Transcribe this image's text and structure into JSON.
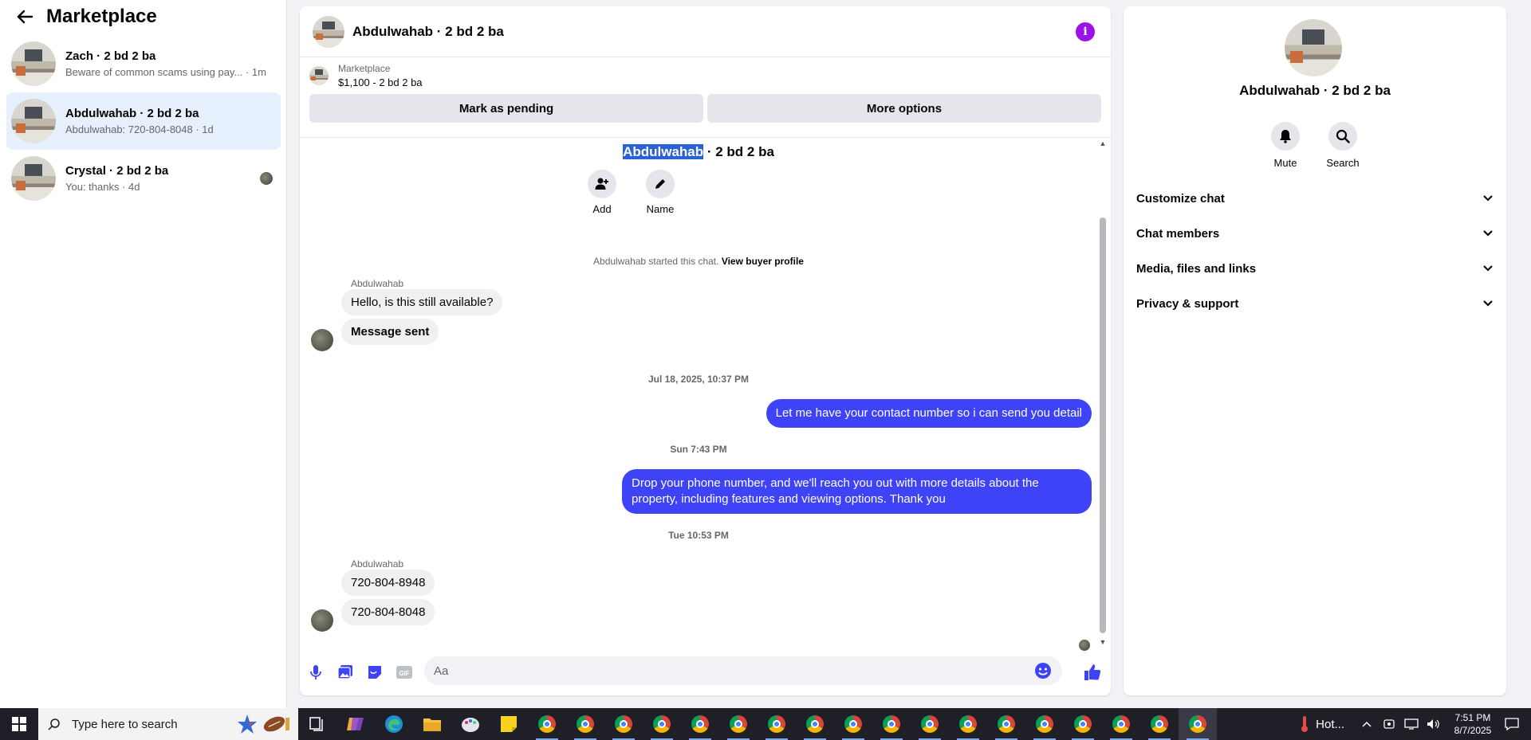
{
  "sidebar": {
    "title": "Marketplace",
    "conversations": [
      {
        "name": "Zach · 2 bd 2 ba",
        "subtitle": "Beware of common scams using pay... · 1m"
      },
      {
        "name": "Abdulwahab · 2 bd 2 ba",
        "subtitle": "Abdulwahab: 720-804-8048 · 1d"
      },
      {
        "name": "Crystal · 2 bd 2 ba",
        "subtitle": "You: thanks · 4d"
      }
    ]
  },
  "chat": {
    "title": "Abdulwahab · 2 bd 2 ba",
    "listing_source": "Marketplace",
    "listing_price": "$1,100 - 2 bd 2 ba",
    "mark_pending_label": "Mark as pending",
    "more_options_label": "More options",
    "conv_title_highlight": "Abdulwahab",
    "conv_title_rest": " · 2 bd 2 ba",
    "add_label": "Add",
    "name_label": "Name",
    "started_text": "Abdulwahab started this chat.",
    "view_profile_label": "View buyer profile",
    "messages": {
      "sender1": "Abdulwahab",
      "in1": "Hello, is this still available?",
      "in2": "Message sent",
      "ts1": "Jul 18, 2025, 10:37 PM",
      "out1": "Let me have your contact number so i can send you detail",
      "ts2": "Sun 7:43 PM",
      "out2": "Drop your phone number, and we'll reach you out with more details about the property, including features and viewing options.  Thank you",
      "ts3": "Tue 10:53 PM",
      "sender2": "Abdulwahab",
      "in3": "720-804-8948",
      "in4": "720-804-8048"
    },
    "composer_placeholder": "Aa",
    "composer_icons": [
      "microphone-icon",
      "photo-icon",
      "sticker-icon",
      "gif-icon",
      "emoji-icon",
      "thumbs-up-icon"
    ],
    "accent_color": "#3f43f7"
  },
  "right_panel": {
    "name": "Abdulwahab · 2 bd 2 ba",
    "mute_label": "Mute",
    "search_label": "Search",
    "sections": [
      "Customize chat",
      "Chat members",
      "Media, files and links",
      "Privacy & support"
    ]
  },
  "taskbar": {
    "search_placeholder": "Type here to search",
    "weather_text": "Hot...",
    "time": "7:51 PM",
    "date": "8/7/2025"
  }
}
